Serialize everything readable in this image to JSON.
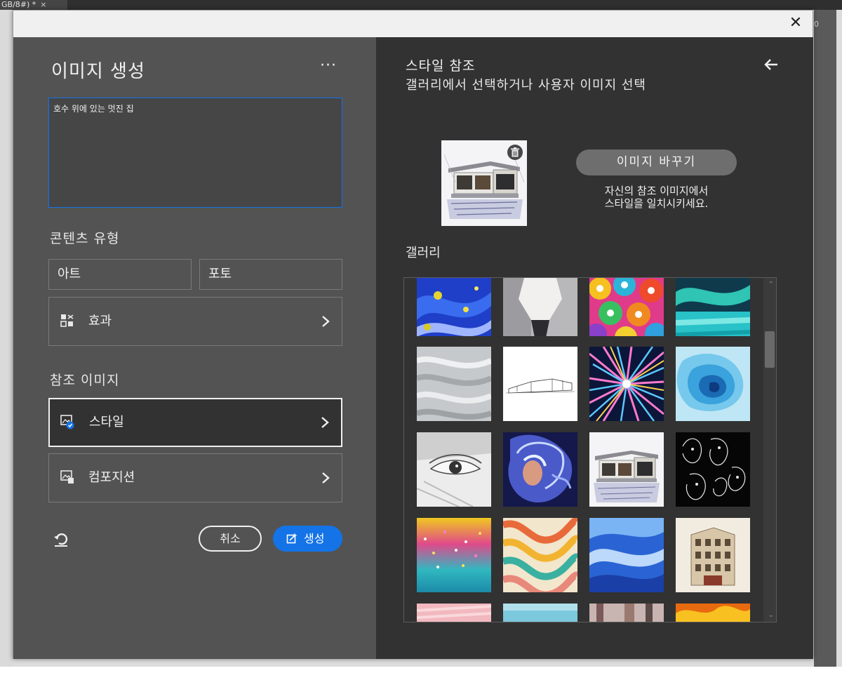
{
  "background": {
    "tab_label": "GB/8#) *",
    "tab_close": "×",
    "right_strip_number": "0"
  },
  "dialog": {
    "close_glyph": "✕"
  },
  "left": {
    "title": "이미지 생성",
    "more_glyph": "···",
    "prompt_value": "호수 위에 있는 멋진 집",
    "content_type_label": "콘텐츠 유형",
    "type_art": "아트",
    "type_photo": "포토",
    "effects_label": "효과",
    "reference_label": "참조 이미지",
    "style_label": "스타일",
    "composition_label": "컴포지션",
    "cancel_label": "취소",
    "generate_label": "생성"
  },
  "right": {
    "title": "스타일 참조",
    "subtitle": "갤러리에서 선택하거나 사용자 이미지 선택",
    "replace_label": "이미지 바꾸기",
    "replace_desc_line1": "자신의 참조 이미지에서",
    "replace_desc_line2": "스타일을 일치시키세요.",
    "gallery_label": "갤러리",
    "scroll_up": "⌃",
    "scroll_down": "⌄"
  },
  "colors": {
    "accent": "#1473e6",
    "left_panel": "#535353",
    "right_panel": "#323232"
  }
}
